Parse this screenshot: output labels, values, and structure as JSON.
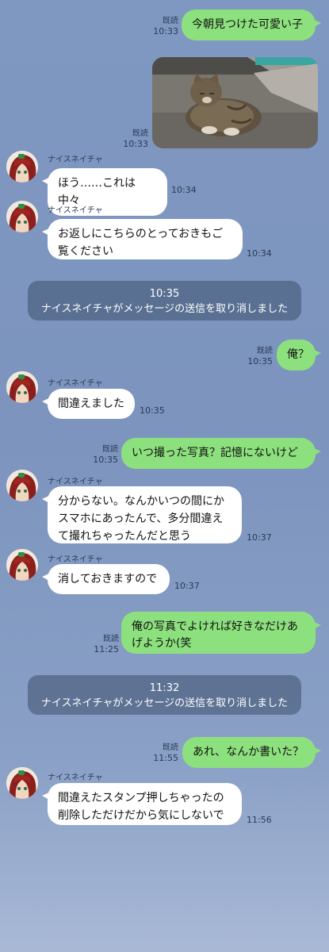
{
  "contact_name": "ナイスネイチャ",
  "read_label": "既読",
  "messages": [
    {
      "text": "今朝見つけた可愛い子",
      "time": "10:33"
    },
    {
      "time": "10:33"
    },
    {
      "text": "ほう……これは中々",
      "time": "10:34"
    },
    {
      "text": "お返しにこちらのとっておきもご覧ください",
      "line1": "お返しにこちらのとっておきもご",
      "line2": "覧ください",
      "time": "10:34"
    },
    {
      "text": "俺？",
      "time": "10:35"
    },
    {
      "text": "間違えました",
      "time": "10:35"
    },
    {
      "text": "いつ撮った写真？記憶にないけど",
      "time": "10:35"
    },
    {
      "line1": "分からない。なんかいつの間にか",
      "line2": "スマホにあったんで、多分間違え",
      "line3": "て撮れちゃったんだと思う",
      "time": "10:37"
    },
    {
      "text": "消しておきますので",
      "time": "10:37"
    },
    {
      "line1": "俺の写真でよければ好きなだけあ",
      "line2": "げようか(笑",
      "time": "11:25"
    },
    {
      "text": "あれ、なんか書いた？",
      "time": "11:55"
    },
    {
      "line1": "間違えたスタンプ押しちゃったの",
      "line2": "削除しただけだから気にしないで",
      "time": "11:56"
    }
  ],
  "notices": [
    {
      "time": "10:35",
      "text": "ナイスネイチャがメッセージの送信を取り消しました"
    },
    {
      "time": "11:32",
      "text": "ナイスネイチャがメッセージの送信を取り消しました"
    }
  ],
  "colors": {
    "my_bubble": "#8de07e",
    "their_bubble": "#ffffff",
    "background": "#7f98c2",
    "notice": "#4b5b78"
  },
  "icons": {
    "avatar": "avatar-nice-nature",
    "photo": "cat-photo"
  }
}
